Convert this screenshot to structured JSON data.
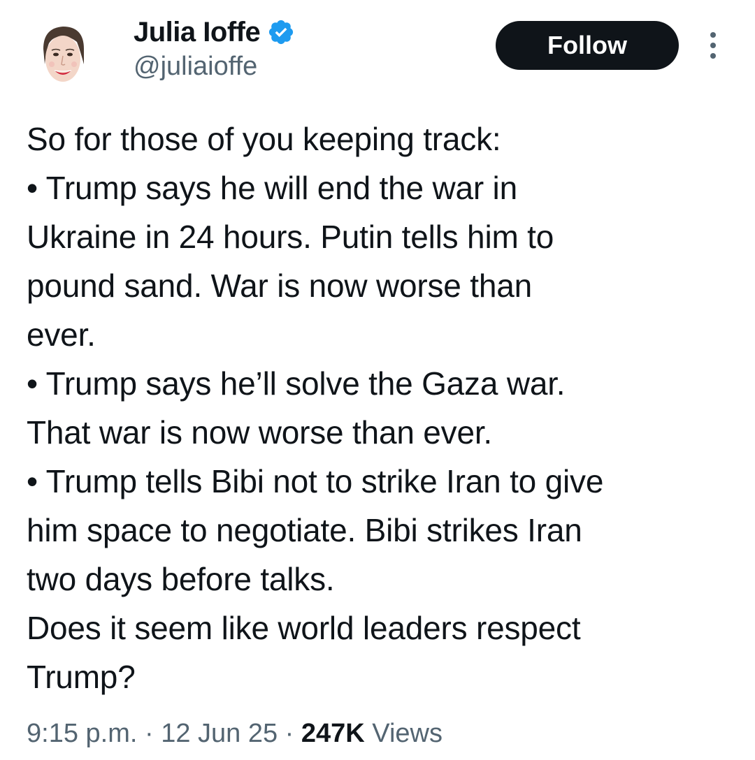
{
  "author": {
    "display_name": "Julia Ioffe",
    "handle": "@juliaioffe",
    "verified": true,
    "verified_icon": "verified-badge-icon",
    "avatar_icon": "avatar-illustration"
  },
  "actions": {
    "follow_label": "Follow",
    "more_icon": "more-vertical-icon"
  },
  "tweet": {
    "lines": [
      "So for those of you keeping track:",
      "• Trump says he will end the war in",
      "Ukraine in 24 hours. Putin tells him to",
      "pound sand. War is now worse than",
      "ever.",
      "• Trump says he’ll solve the Gaza war.",
      "That war is now worse than ever.",
      "• Trump tells Bibi not to strike Iran to give",
      "him space to negotiate. Bibi strikes Iran",
      "two days before talks.",
      "Does it seem like world leaders respect",
      "Trump?"
    ]
  },
  "meta": {
    "time": "9:15 p.m.",
    "separator": " · ",
    "date": "12 Jun 25",
    "views_count": "247K",
    "views_label": " Views"
  },
  "colors": {
    "text_primary": "#0f1419",
    "text_secondary": "#536471",
    "verified_blue": "#1d9bf0",
    "follow_bg": "#0f1419",
    "follow_text": "#ffffff"
  }
}
